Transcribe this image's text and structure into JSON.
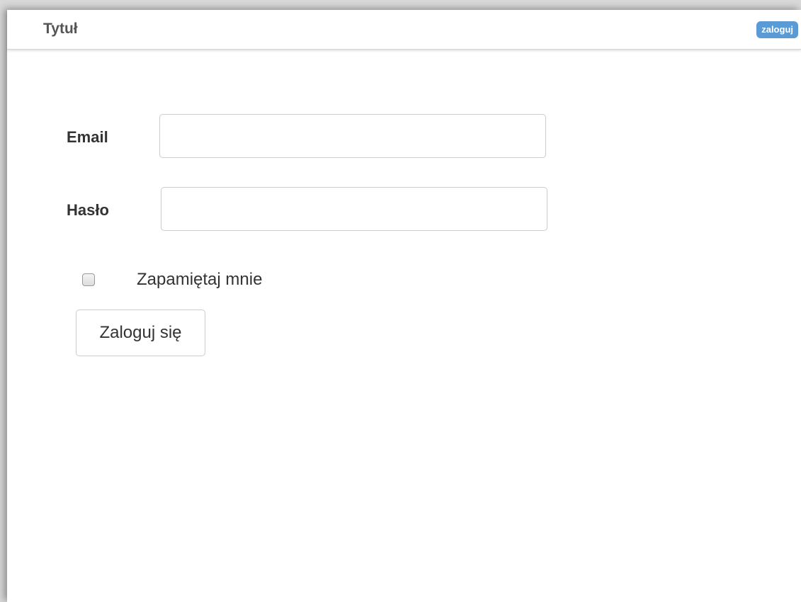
{
  "header": {
    "title": "Tytuł",
    "login_button": "zaloguj"
  },
  "form": {
    "email_label": "Email",
    "email_value": "",
    "password_label": "Hasło",
    "password_value": "",
    "remember_label": "Zapamiętaj mnie",
    "remember_checked": false,
    "submit_label": "Zaloguj się"
  },
  "colors": {
    "accent": "#5b9bd5",
    "border": "#cccccc",
    "text": "#333333"
  }
}
